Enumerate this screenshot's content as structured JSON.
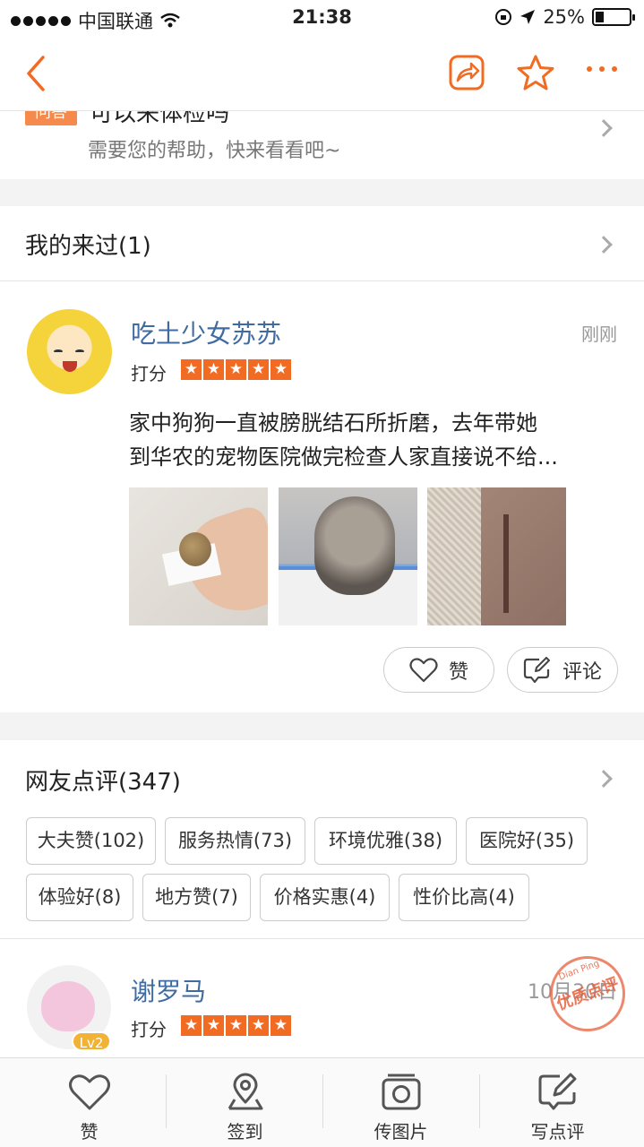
{
  "status_bar": {
    "carrier": "中国联通",
    "time": "21:38",
    "battery": "25%",
    "battery_level": 0.25
  },
  "nav": {
    "icons": [
      "back-icon",
      "share-icon",
      "star-icon",
      "more-icon"
    ]
  },
  "question": {
    "tag": "问答",
    "title": "可以来体检吗",
    "subtitle": "需要您的帮助，快来看看吧~"
  },
  "visits": {
    "title": "我的来过(1)"
  },
  "my_review": {
    "username": "吃土少女苏苏",
    "time": "刚刚",
    "score_label": "打分",
    "rating": 5,
    "text_line1": "家中狗狗一直被膀胱结石所折磨，去年带她",
    "text_line2": "到华农的宠物医院做完检查人家直接说不给...",
    "like_label": "赞",
    "comment_label": "评论"
  },
  "reviews": {
    "title": "网友点评(347)",
    "tags": [
      {
        "label": "大夫赞(102)"
      },
      {
        "label": "服务热情(73)"
      },
      {
        "label": "环境优雅(38)"
      },
      {
        "label": "医院好(35)"
      },
      {
        "label": "体验好(8)"
      },
      {
        "label": "地方赞(7)"
      },
      {
        "label": "价格实惠(4)"
      },
      {
        "label": "性价比高(4)"
      }
    ]
  },
  "review2": {
    "username": "谢罗马",
    "level": "Lv2",
    "time": "10月30日",
    "score_label": "打分",
    "rating": 5,
    "stamp_top": "Dian Ping",
    "stamp_text": "优质点评"
  },
  "bottom_tabs": [
    {
      "label": "赞",
      "icon": "heart-icon"
    },
    {
      "label": "签到",
      "icon": "location-pin-icon"
    },
    {
      "label": "传图片",
      "icon": "camera-icon"
    },
    {
      "label": "写点评",
      "icon": "edit-icon"
    }
  ],
  "colors": {
    "accent": "#f26b22",
    "username": "#3f6ba1",
    "muted": "#999999"
  }
}
